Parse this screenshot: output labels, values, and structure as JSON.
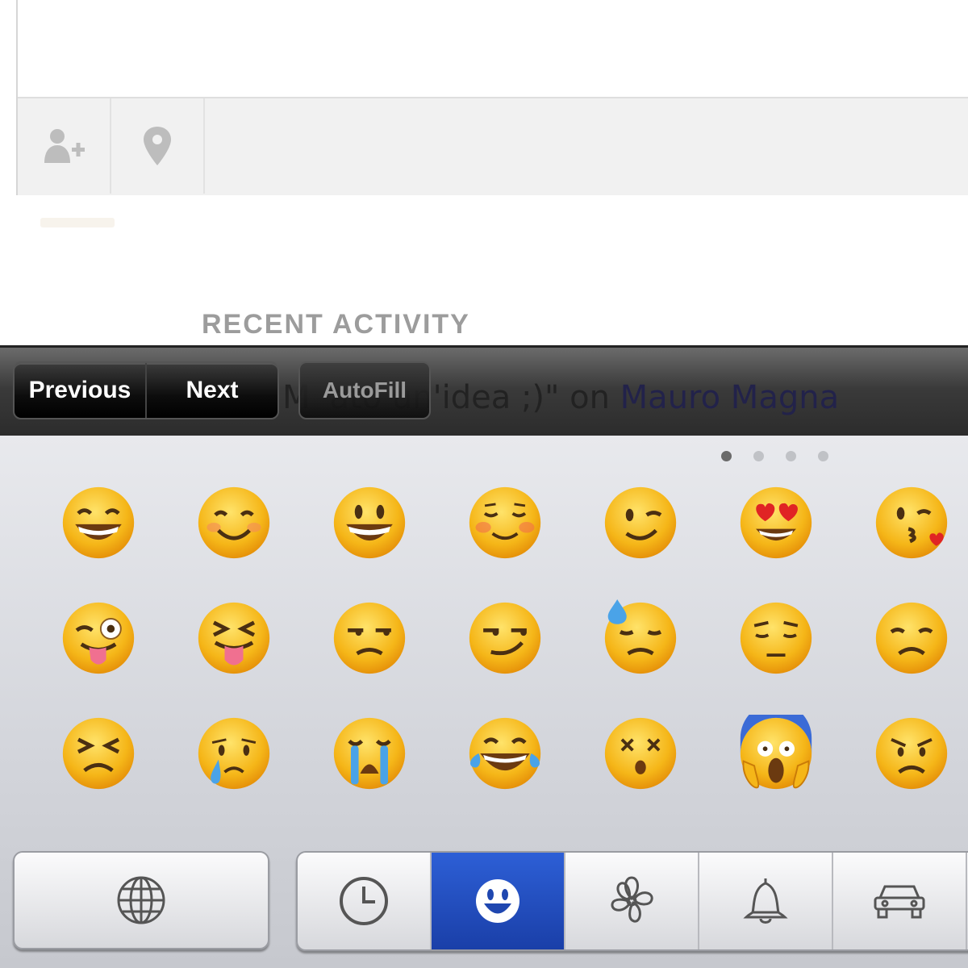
{
  "composer": {
    "tag_people_icon": "add-person-icon",
    "location_icon": "location-pin-icon"
  },
  "recent_activity": {
    "title": "RECENT ACTIVITY",
    "partial_text": "M",
    "partial_text_2": "ato un'idea ;)\" on ",
    "partial_link": "Mauro Magna"
  },
  "toolbar": {
    "previous_label": "Previous",
    "next_label": "Next",
    "autofill_label": "AutoFill"
  },
  "emoji_keyboard": {
    "page_dots": 4,
    "active_page": 1,
    "emojis": [
      "grinning-squinting-face",
      "smiling-face-blush",
      "grinning-face",
      "relaxed-face",
      "winking-face",
      "heart-eyes-face",
      "kissing-heart-face",
      "winking-tongue-face",
      "squinting-tongue-face",
      "unamused-face",
      "smirking-face",
      "downcast-sweat-face",
      "pensive-face",
      "disappointed-face",
      "persevering-face",
      "crying-face",
      "loudly-crying-face",
      "tears-of-joy-face",
      "dizzy-face",
      "screaming-face",
      "angry-face"
    ],
    "globe_icon": "globe-icon",
    "categories": [
      {
        "name": "recent",
        "icon": "clock-icon",
        "active": false
      },
      {
        "name": "people",
        "icon": "smiley-icon",
        "active": true
      },
      {
        "name": "nature",
        "icon": "flower-icon",
        "active": false
      },
      {
        "name": "objects",
        "icon": "bell-icon",
        "active": false
      },
      {
        "name": "places",
        "icon": "car-icon",
        "active": false
      }
    ],
    "colors": {
      "face": "#f5b618",
      "active_category": "#2552c4"
    }
  }
}
